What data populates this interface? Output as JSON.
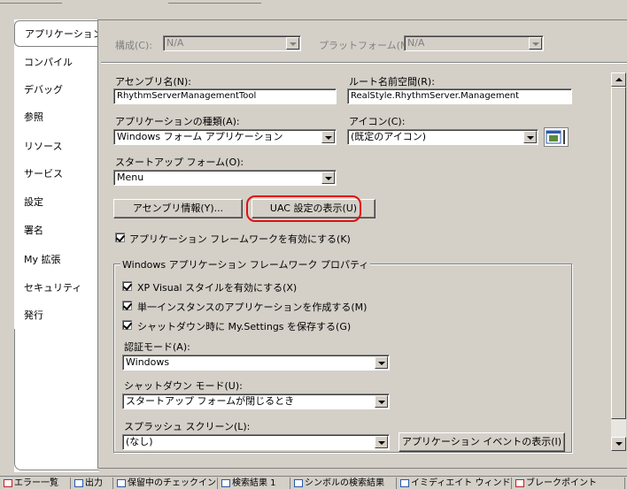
{
  "tabs": [
    {
      "label": "アプリケーション",
      "active": true
    },
    {
      "label": "コンパイル"
    },
    {
      "label": "デバッグ"
    },
    {
      "label": "参照"
    },
    {
      "label": "リソース"
    },
    {
      "label": "サービス"
    },
    {
      "label": "設定"
    },
    {
      "label": "署名"
    },
    {
      "label": "My 拡張"
    },
    {
      "label": "セキュリティ"
    },
    {
      "label": "発行"
    }
  ],
  "config": {
    "configuration_label": "構成(C):",
    "configuration_value": "N/A",
    "platform_label": "プラットフォーム(M):",
    "platform_value": "N/A"
  },
  "form": {
    "assembly_name_label": "アセンブリ名(N):",
    "assembly_name_value": "RhythmServerManagementTool",
    "root_namespace_label": "ルート名前空間(R):",
    "root_namespace_value": "RealStyle.RhythmServer.Management",
    "app_type_label": "アプリケーションの種類(A):",
    "app_type_value": "Windows フォーム アプリケーション",
    "icon_label": "アイコン(C):",
    "icon_value": "(既定のアイコン)",
    "startup_form_label": "スタートアップ フォーム(O):",
    "startup_form_value": "Menu",
    "assembly_info_button": "アセンブリ情報(Y)...",
    "uac_button": "UAC 設定の表示(U)",
    "enable_framework_label": "アプリケーション フレームワークを有効にする(K)"
  },
  "framework_group": {
    "legend": "Windows アプリケーション フレームワーク プロパティ",
    "xp_styles_label": "XP Visual スタイルを有効にする(X)",
    "single_instance_label": "単一インスタンスのアプリケーションを作成する(M)",
    "save_settings_label": "シャットダウン時に My.Settings を保存する(G)",
    "auth_mode_label": "認証モード(A):",
    "auth_mode_value": "Windows",
    "shutdown_mode_label": "シャットダウン モード(U):",
    "shutdown_mode_value": "スタートアップ フォームが閉じるとき",
    "splash_label": "スプラッシュ スクリーン(L):",
    "splash_value": "(なし)",
    "view_events_button": "アプリケーション イベントの表示(I)"
  },
  "bottom_tabs": [
    {
      "label": "エラー一覧",
      "icon": "error-list-icon"
    },
    {
      "label": "出力",
      "icon": "output-icon"
    },
    {
      "label": "保留中のチェックイン",
      "icon": "pending-checkins-icon"
    },
    {
      "label": "検索結果 1",
      "icon": "find-results-icon"
    },
    {
      "label": "シンボルの検索結果",
      "icon": "symbol-results-icon"
    },
    {
      "label": "イミディエイト ウィンドウ",
      "icon": "immediate-window-icon"
    },
    {
      "label": "ブレークポイント",
      "icon": "breakpoints-icon"
    }
  ],
  "colors": {
    "highlight_circle": "#e01010",
    "chrome": "#d4d0c8"
  }
}
